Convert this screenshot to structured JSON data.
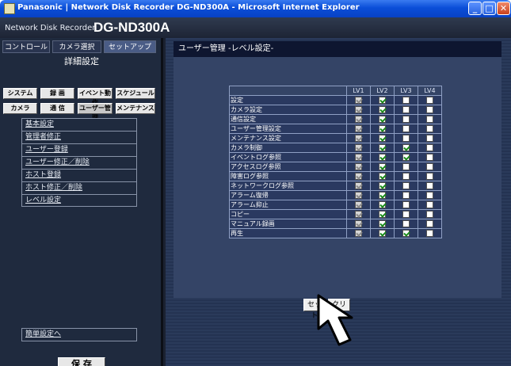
{
  "window": {
    "title": "Panasonic | Network Disk Recorder DG-ND300A - Microsoft Internet Explorer"
  },
  "brand": {
    "sub": "Network Disk Recorder",
    "model": "DG-ND300A"
  },
  "top_tabs": [
    "コントロール",
    "カメラ選択",
    "セットアップ"
  ],
  "detail_title": "詳細設定",
  "setup_buttons_row1": [
    "システム",
    "録 画",
    "イベント動作",
    "スケジュール"
  ],
  "setup_buttons_row2": [
    "カメラ",
    "通 信",
    "ユーザー管理",
    "メンテナンス"
  ],
  "menu": [
    "基本設定",
    "管理者修正",
    "ユーザー登録",
    "ユーザー修正／削除",
    "ホスト登録",
    "ホスト修正／削除",
    "レベル設定"
  ],
  "simple_link": "簡単設定へ",
  "save_label": "保 存",
  "page_title": "ユーザー管理 -レベル設定-",
  "levels": [
    "LV1",
    "LV2",
    "LV3",
    "LV4"
  ],
  "rows": [
    {
      "label": "設定",
      "checks": [
        true,
        true,
        false,
        false
      ]
    },
    {
      "label": "カメラ設定",
      "checks": [
        true,
        true,
        false,
        false
      ]
    },
    {
      "label": "通信設定",
      "checks": [
        true,
        true,
        false,
        false
      ]
    },
    {
      "label": "ユーザー管理設定",
      "checks": [
        true,
        true,
        false,
        false
      ]
    },
    {
      "label": "メンテナンス設定",
      "checks": [
        true,
        true,
        false,
        false
      ]
    },
    {
      "label": "カメラ制御",
      "checks": [
        true,
        true,
        true,
        false
      ]
    },
    {
      "label": "イベントログ参照",
      "checks": [
        true,
        true,
        true,
        false
      ]
    },
    {
      "label": "アクセスログ参照",
      "checks": [
        true,
        true,
        false,
        false
      ]
    },
    {
      "label": "障害ログ参照",
      "checks": [
        true,
        true,
        false,
        false
      ]
    },
    {
      "label": "ネットワークログ参照",
      "checks": [
        true,
        true,
        false,
        false
      ]
    },
    {
      "label": "アラーム復帰",
      "checks": [
        true,
        true,
        false,
        false
      ]
    },
    {
      "label": "アラーム抑止",
      "checks": [
        true,
        true,
        false,
        false
      ]
    },
    {
      "label": "コピー",
      "checks": [
        true,
        true,
        false,
        false
      ]
    },
    {
      "label": "マニュアル録画",
      "checks": [
        true,
        true,
        false,
        false
      ]
    },
    {
      "label": "再生",
      "checks": [
        true,
        true,
        true,
        false
      ]
    }
  ],
  "set_label": "セット",
  "clear_label": "クリア"
}
